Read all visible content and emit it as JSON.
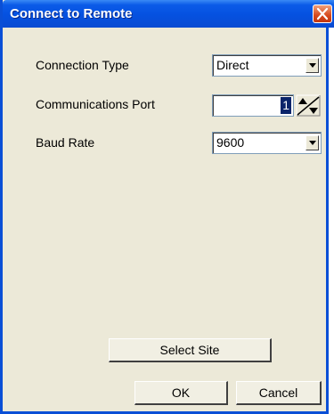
{
  "window": {
    "title": "Connect to Remote"
  },
  "fields": {
    "connection_type": {
      "label": "Connection Type",
      "value": "Direct"
    },
    "communications_port": {
      "label": "Communications Port",
      "value": "1"
    },
    "baud_rate": {
      "label": "Baud Rate",
      "value": "9600"
    }
  },
  "buttons": {
    "select_site": "Select Site",
    "ok": "OK",
    "cancel": "Cancel"
  },
  "icons": {
    "close": "close-icon",
    "dropdown": "chevron-down-icon",
    "spinner": "spinner-arrows-icon"
  },
  "colors": {
    "titlebar": "#0551e0",
    "dialog_bg": "#ece9d8",
    "close_button": "#d6481c",
    "selection": "#0a246a"
  }
}
